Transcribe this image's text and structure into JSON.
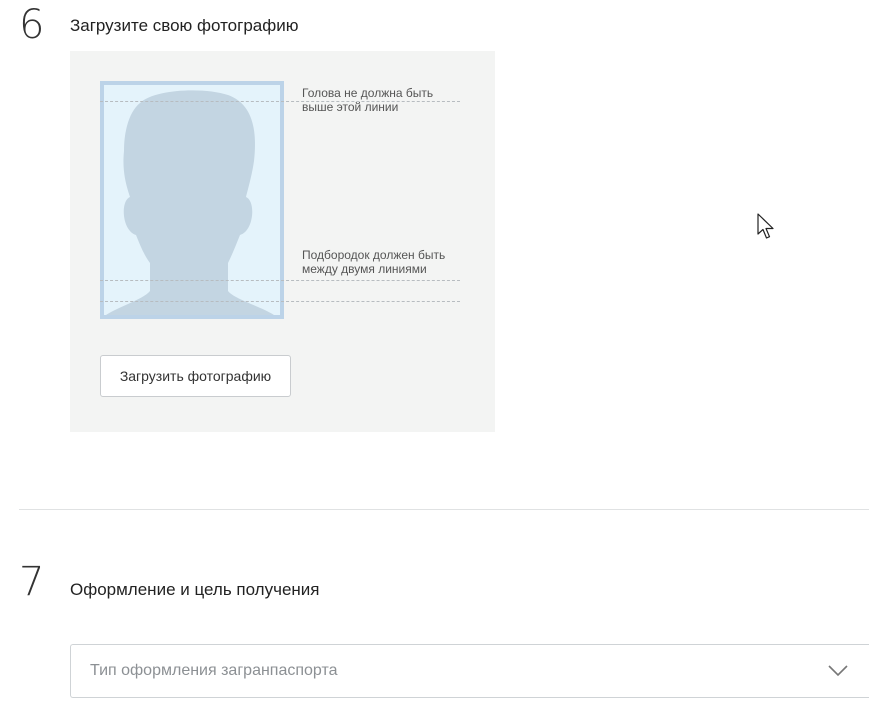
{
  "step6": {
    "number": "6",
    "title": "Загрузите свою фотографию",
    "hint_top_line1": "Голова не должна быть",
    "hint_top_line2": "выше этой линии",
    "hint_chin_line1": "Подбородок должен быть",
    "hint_chin_line2": "между двумя линиями",
    "upload_button_label": "Загрузить фотографию"
  },
  "step7": {
    "number": "7",
    "title": "Оформление и цель получения",
    "select_placeholder": "Тип оформления загранпаспорта"
  },
  "colors": {
    "panel_bg": "#f3f4f3",
    "frame_border": "#bcd3e8",
    "frame_bg": "#e4f3fb",
    "silhouette": "#c3d5e2"
  },
  "icons": {
    "photo_placeholder": "person-silhouette-icon",
    "select_arrow": "chevron-down-icon",
    "cursor": "mouse-pointer-icon"
  }
}
